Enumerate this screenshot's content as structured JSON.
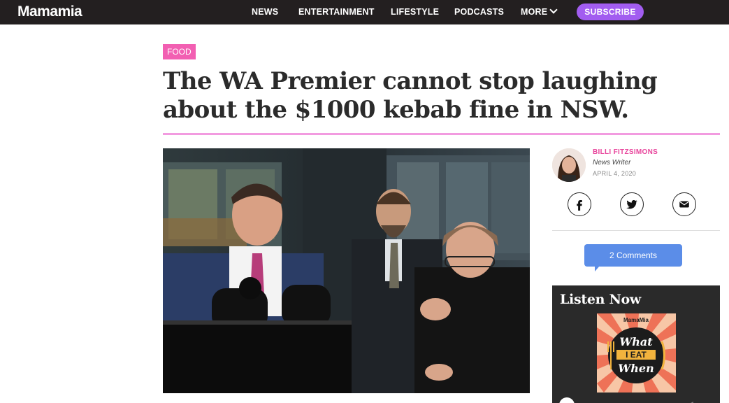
{
  "site": {
    "logo": "Mamamia"
  },
  "nav": {
    "items": [
      "NEWS",
      "ENTERTAINMENT",
      "LIFESTYLE",
      "PODCASTS",
      "MORE"
    ],
    "subscribe": "SUBSCRIBE"
  },
  "article": {
    "category": "FOOD",
    "headline": "The WA Premier cannot stop laughing about the $1000 kebab fine in NSW."
  },
  "author": {
    "name": "BILLI FITZSIMONS",
    "role": "News Writer",
    "date": "APRIL 4, 2020"
  },
  "share": {
    "icons": [
      "facebook-icon",
      "twitter-icon",
      "mail-icon"
    ]
  },
  "comments": {
    "label": "2 Comments"
  },
  "listen": {
    "title": "Listen Now",
    "podcast_brand": "MamaMia",
    "podcast_title_line1": "What",
    "podcast_title_line2": "I EAT",
    "podcast_title_line3": "When"
  },
  "colors": {
    "topbar": "#231f20",
    "subscribe": "#a25df0",
    "category": "#f25fb2",
    "rule": "#f29be0",
    "author_name": "#e8459c",
    "comments": "#5b8de8",
    "listen_bg": "#2a2a2a"
  }
}
